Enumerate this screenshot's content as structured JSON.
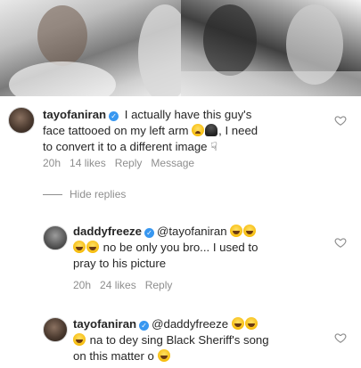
{
  "comments": [
    {
      "username": "tayofaniran",
      "text_1": " I actually have this guy's",
      "text_2": "face tattooed on my left arm",
      "text_3": ", I need",
      "text_4": "to convert it to a different image",
      "time": "20h",
      "likes": "14 likes",
      "reply": "Reply",
      "message": "Message"
    },
    {
      "username": "daddyfreeze",
      "mention": "@tayofaniran",
      "text_2": " no be only you bro... I used to",
      "text_3": "pray to his picture",
      "time": "20h",
      "likes": "24 likes",
      "reply": "Reply"
    },
    {
      "username": "tayofaniran",
      "mention": "@daddyfreeze",
      "text_2": " na to dey sing Black Sheriff's song",
      "text_3": "on this matter o"
    }
  ],
  "hide_replies": "Hide replies",
  "icons": {
    "verified": "verified-badge-icon",
    "heart": "heart-icon",
    "emoji_laugh": "face-with-tears-of-joy-icon",
    "emoji_cry": "crying-face-icon",
    "emoji_bust": "bust-silhouette-icon",
    "emoji_hand": "pointing-down-icon"
  },
  "colors": {
    "verified": "#3897f0",
    "meta_text": "#8e8e8e",
    "body_text": "#262626"
  }
}
